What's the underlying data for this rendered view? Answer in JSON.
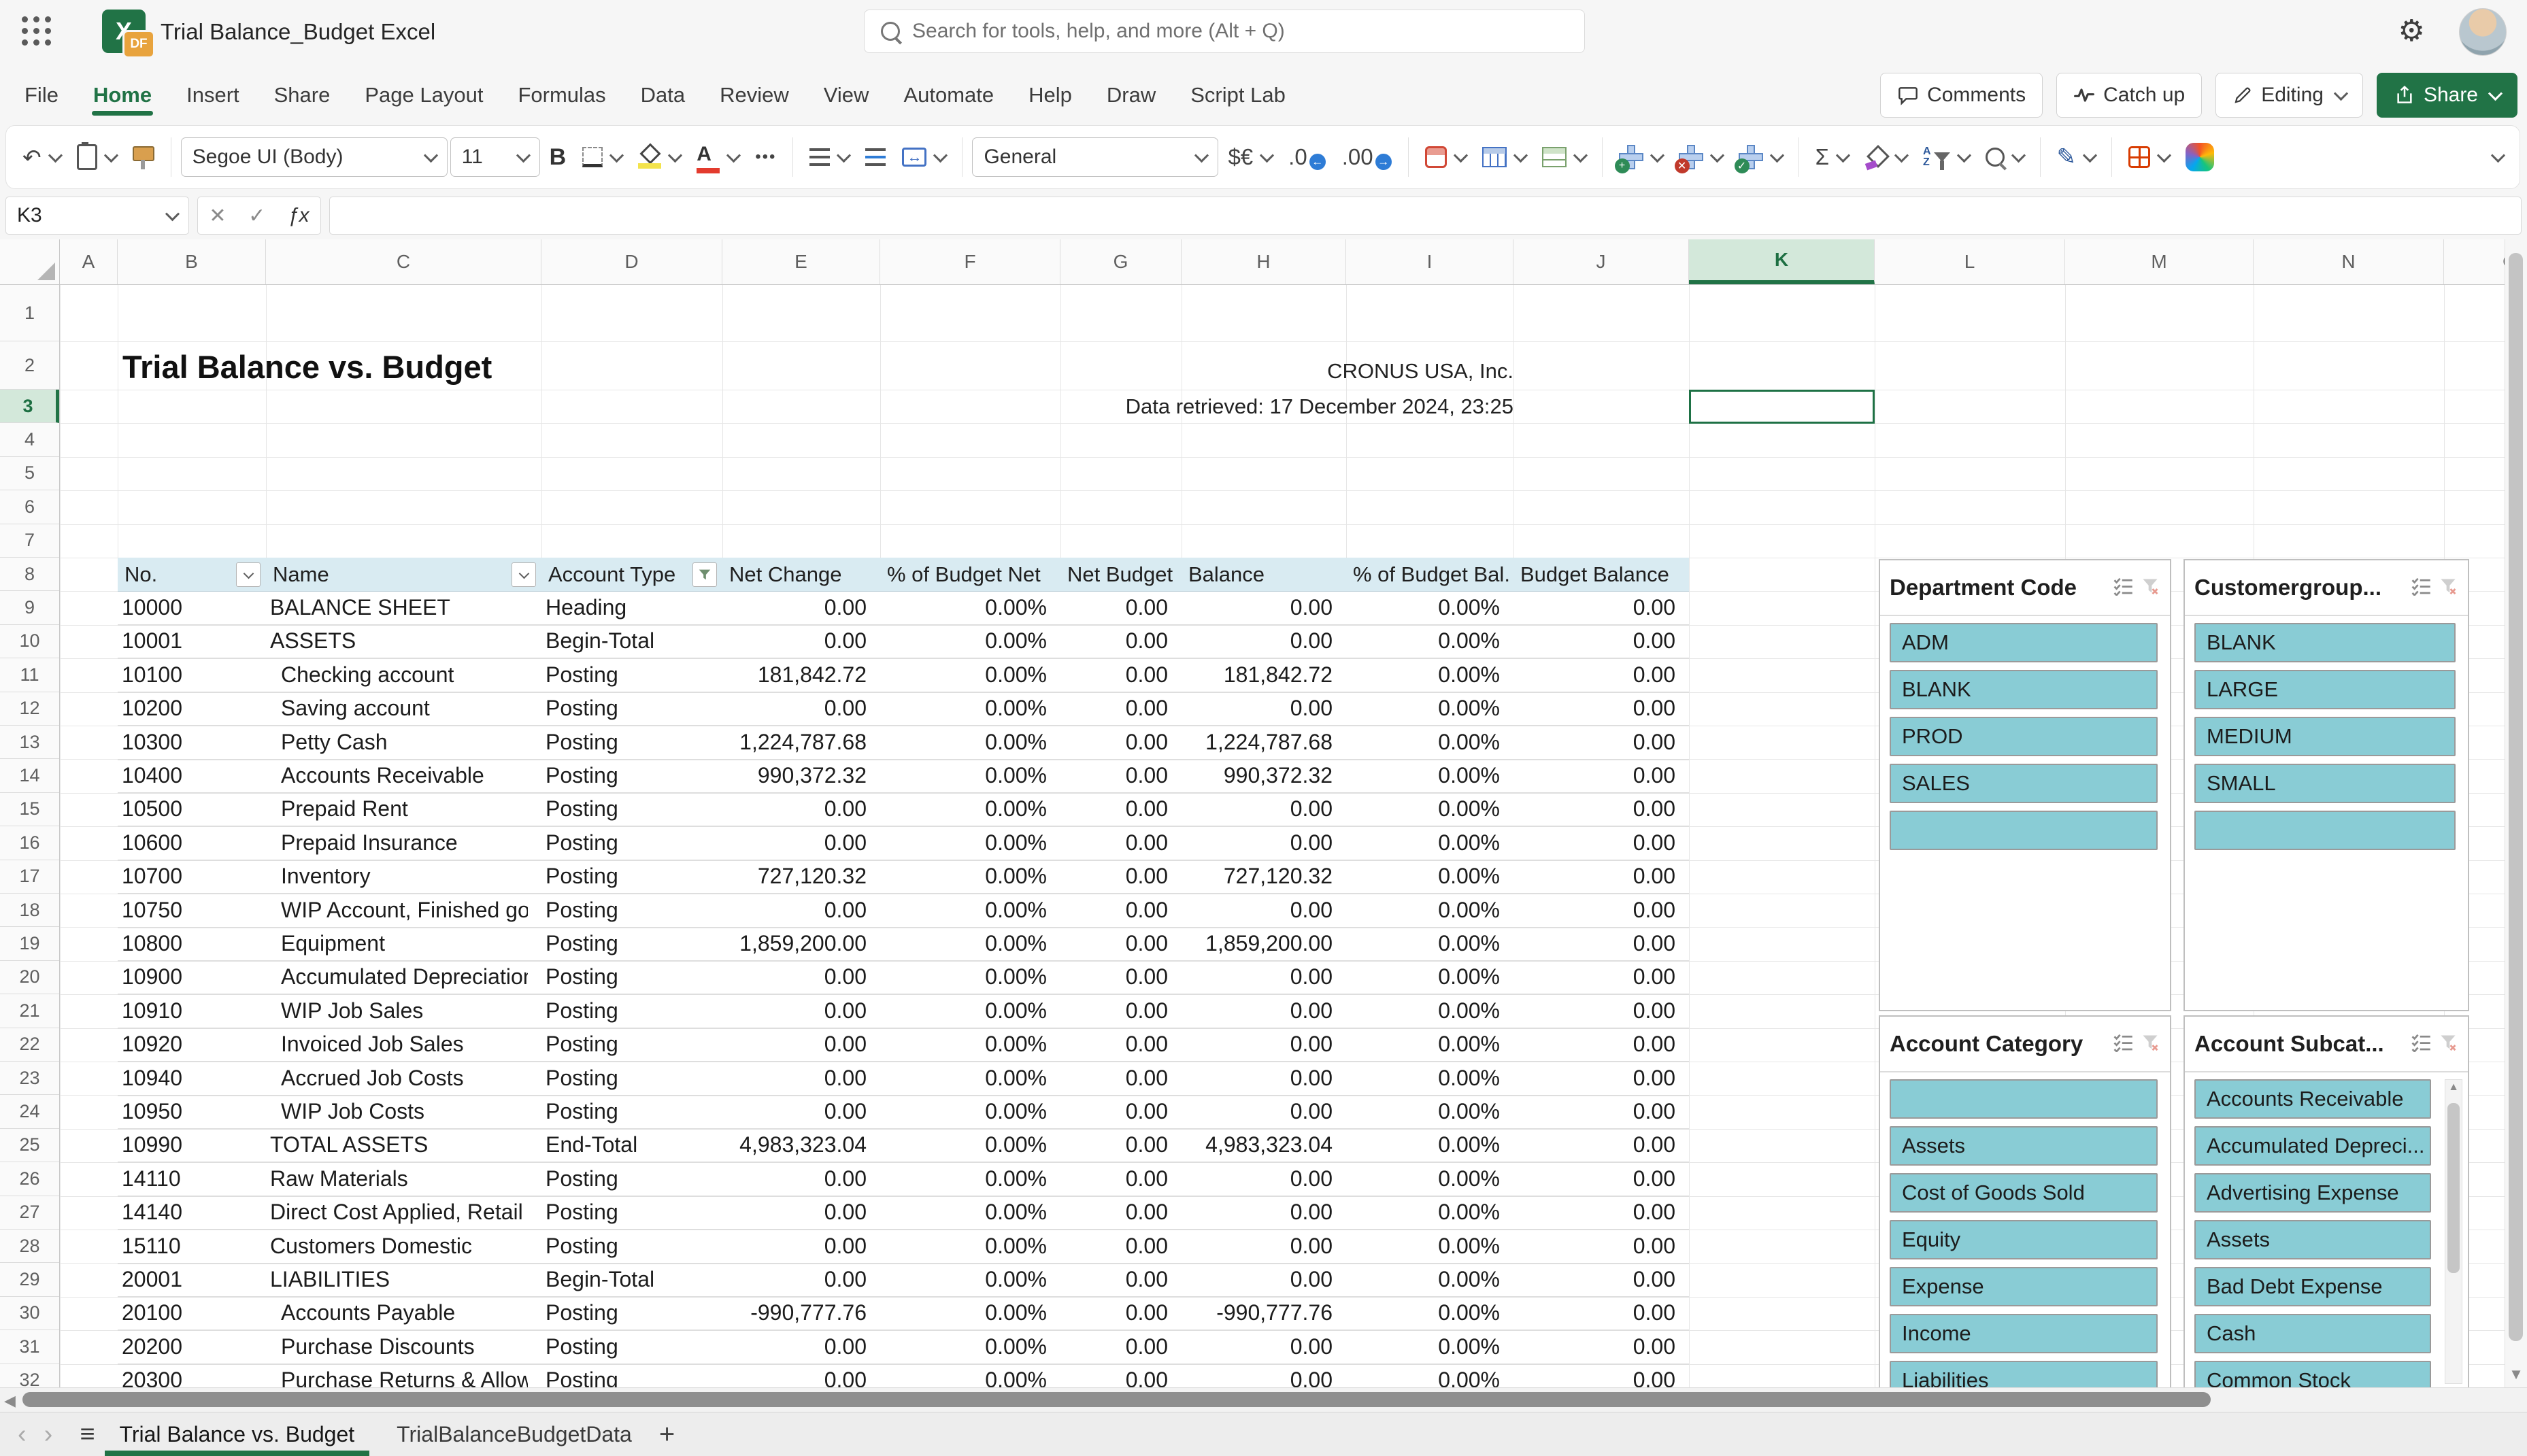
{
  "titlebar": {
    "app_title": "Trial Balance_Budget Excel",
    "search_placeholder": "Search for tools, help, and more (Alt + Q)",
    "excel_badge": "X",
    "df_badge": "DF"
  },
  "menubar": {
    "tabs": [
      "File",
      "Home",
      "Insert",
      "Share",
      "Page Layout",
      "Formulas",
      "Data",
      "Review",
      "View",
      "Automate",
      "Help",
      "Draw",
      "Script Lab"
    ],
    "active_tab": "Home",
    "comments_label": "Comments",
    "catchup_label": "Catch up",
    "editing_label": "Editing",
    "share_label": "Share"
  },
  "toolbar": {
    "font_name": "Segoe UI (Body)",
    "font_size": "11",
    "number_format": "General"
  },
  "formula_bar": {
    "cell_ref": "K3",
    "formula_value": ""
  },
  "sheet": {
    "columns": [
      "A",
      "B",
      "C",
      "D",
      "E",
      "F",
      "G",
      "H",
      "I",
      "J",
      "K",
      "L",
      "M",
      "N",
      "O"
    ],
    "selected_column": "K",
    "row_count": 32,
    "selected_row": 3,
    "title": "Trial Balance vs. Budget",
    "company": "CRONUS USA, Inc.",
    "retrieved": "Data retrieved: 17 December 2024, 23:25"
  },
  "table": {
    "headers": [
      "No.",
      "Name",
      "Account Type",
      "Net Change",
      "% of Budget Net",
      "Net Budget",
      "Balance",
      "% of Budget Bal.",
      "Budget Balance"
    ],
    "rows": [
      {
        "no": "10000",
        "name": "BALANCE SHEET",
        "indent": 0,
        "type": "Heading",
        "net_change": "0.00",
        "pct_net": "0.00%",
        "net_budget": "0.00",
        "balance": "0.00",
        "pct_bal": "0.00%",
        "budget_balance": "0.00"
      },
      {
        "no": "10001",
        "name": "ASSETS",
        "indent": 0,
        "type": "Begin-Total",
        "net_change": "0.00",
        "pct_net": "0.00%",
        "net_budget": "0.00",
        "balance": "0.00",
        "pct_bal": "0.00%",
        "budget_balance": "0.00"
      },
      {
        "no": "10100",
        "name": "Checking account",
        "indent": 1,
        "type": "Posting",
        "net_change": "181,842.72",
        "pct_net": "0.00%",
        "net_budget": "0.00",
        "balance": "181,842.72",
        "pct_bal": "0.00%",
        "budget_balance": "0.00"
      },
      {
        "no": "10200",
        "name": "Saving account",
        "indent": 1,
        "type": "Posting",
        "net_change": "0.00",
        "pct_net": "0.00%",
        "net_budget": "0.00",
        "balance": "0.00",
        "pct_bal": "0.00%",
        "budget_balance": "0.00"
      },
      {
        "no": "10300",
        "name": "Petty Cash",
        "indent": 1,
        "type": "Posting",
        "net_change": "1,224,787.68",
        "pct_net": "0.00%",
        "net_budget": "0.00",
        "balance": "1,224,787.68",
        "pct_bal": "0.00%",
        "budget_balance": "0.00"
      },
      {
        "no": "10400",
        "name": "Accounts Receivable",
        "indent": 1,
        "type": "Posting",
        "net_change": "990,372.32",
        "pct_net": "0.00%",
        "net_budget": "0.00",
        "balance": "990,372.32",
        "pct_bal": "0.00%",
        "budget_balance": "0.00"
      },
      {
        "no": "10500",
        "name": "Prepaid Rent",
        "indent": 1,
        "type": "Posting",
        "net_change": "0.00",
        "pct_net": "0.00%",
        "net_budget": "0.00",
        "balance": "0.00",
        "pct_bal": "0.00%",
        "budget_balance": "0.00"
      },
      {
        "no": "10600",
        "name": "Prepaid Insurance",
        "indent": 1,
        "type": "Posting",
        "net_change": "0.00",
        "pct_net": "0.00%",
        "net_budget": "0.00",
        "balance": "0.00",
        "pct_bal": "0.00%",
        "budget_balance": "0.00"
      },
      {
        "no": "10700",
        "name": "Inventory",
        "indent": 1,
        "type": "Posting",
        "net_change": "727,120.32",
        "pct_net": "0.00%",
        "net_budget": "0.00",
        "balance": "727,120.32",
        "pct_bal": "0.00%",
        "budget_balance": "0.00"
      },
      {
        "no": "10750",
        "name": "WIP Account, Finished goods",
        "indent": 1,
        "type": "Posting",
        "net_change": "0.00",
        "pct_net": "0.00%",
        "net_budget": "0.00",
        "balance": "0.00",
        "pct_bal": "0.00%",
        "budget_balance": "0.00"
      },
      {
        "no": "10800",
        "name": "Equipment",
        "indent": 1,
        "type": "Posting",
        "net_change": "1,859,200.00",
        "pct_net": "0.00%",
        "net_budget": "0.00",
        "balance": "1,859,200.00",
        "pct_bal": "0.00%",
        "budget_balance": "0.00"
      },
      {
        "no": "10900",
        "name": "Accumulated Depreciation",
        "indent": 1,
        "type": "Posting",
        "net_change": "0.00",
        "pct_net": "0.00%",
        "net_budget": "0.00",
        "balance": "0.00",
        "pct_bal": "0.00%",
        "budget_balance": "0.00"
      },
      {
        "no": "10910",
        "name": "WIP Job Sales",
        "indent": 1,
        "type": "Posting",
        "net_change": "0.00",
        "pct_net": "0.00%",
        "net_budget": "0.00",
        "balance": "0.00",
        "pct_bal": "0.00%",
        "budget_balance": "0.00"
      },
      {
        "no": "10920",
        "name": "Invoiced Job Sales",
        "indent": 1,
        "type": "Posting",
        "net_change": "0.00",
        "pct_net": "0.00%",
        "net_budget": "0.00",
        "balance": "0.00",
        "pct_bal": "0.00%",
        "budget_balance": "0.00"
      },
      {
        "no": "10940",
        "name": "Accrued Job Costs",
        "indent": 1,
        "type": "Posting",
        "net_change": "0.00",
        "pct_net": "0.00%",
        "net_budget": "0.00",
        "balance": "0.00",
        "pct_bal": "0.00%",
        "budget_balance": "0.00"
      },
      {
        "no": "10950",
        "name": "WIP Job Costs",
        "indent": 1,
        "type": "Posting",
        "net_change": "0.00",
        "pct_net": "0.00%",
        "net_budget": "0.00",
        "balance": "0.00",
        "pct_bal": "0.00%",
        "budget_balance": "0.00"
      },
      {
        "no": "10990",
        "name": "TOTAL ASSETS",
        "indent": 0,
        "type": "End-Total",
        "net_change": "4,983,323.04",
        "pct_net": "0.00%",
        "net_budget": "0.00",
        "balance": "4,983,323.04",
        "pct_bal": "0.00%",
        "budget_balance": "0.00"
      },
      {
        "no": "14110",
        "name": "Raw Materials",
        "indent": 0,
        "type": "Posting",
        "net_change": "0.00",
        "pct_net": "0.00%",
        "net_budget": "0.00",
        "balance": "0.00",
        "pct_bal": "0.00%",
        "budget_balance": "0.00"
      },
      {
        "no": "14140",
        "name": "Direct Cost Applied, Retail",
        "indent": 0,
        "type": "Posting",
        "net_change": "0.00",
        "pct_net": "0.00%",
        "net_budget": "0.00",
        "balance": "0.00",
        "pct_bal": "0.00%",
        "budget_balance": "0.00"
      },
      {
        "no": "15110",
        "name": "Customers Domestic",
        "indent": 0,
        "type": "Posting",
        "net_change": "0.00",
        "pct_net": "0.00%",
        "net_budget": "0.00",
        "balance": "0.00",
        "pct_bal": "0.00%",
        "budget_balance": "0.00"
      },
      {
        "no": "20001",
        "name": "LIABILITIES",
        "indent": 0,
        "type": "Begin-Total",
        "net_change": "0.00",
        "pct_net": "0.00%",
        "net_budget": "0.00",
        "balance": "0.00",
        "pct_bal": "0.00%",
        "budget_balance": "0.00"
      },
      {
        "no": "20100",
        "name": "Accounts Payable",
        "indent": 1,
        "type": "Posting",
        "net_change": "-990,777.76",
        "pct_net": "0.00%",
        "net_budget": "0.00",
        "balance": "-990,777.76",
        "pct_bal": "0.00%",
        "budget_balance": "0.00"
      },
      {
        "no": "20200",
        "name": "Purchase Discounts",
        "indent": 1,
        "type": "Posting",
        "net_change": "0.00",
        "pct_net": "0.00%",
        "net_budget": "0.00",
        "balance": "0.00",
        "pct_bal": "0.00%",
        "budget_balance": "0.00"
      },
      {
        "no": "20300",
        "name": "Purchase Returns & Allowances",
        "indent": 1,
        "type": "Posting",
        "net_change": "0.00",
        "pct_net": "0.00%",
        "net_budget": "0.00",
        "balance": "0.00",
        "pct_bal": "0.00%",
        "budget_balance": "0.00"
      }
    ]
  },
  "slicers": [
    {
      "title": "Department Code",
      "items": [
        "ADM",
        "BLANK",
        "PROD",
        "SALES",
        ""
      ]
    },
    {
      "title": "Customergroup...",
      "items": [
        "BLANK",
        "LARGE",
        "MEDIUM",
        "SMALL",
        ""
      ]
    },
    {
      "title": "Account Category",
      "items": [
        "",
        "Assets",
        "Cost of Goods Sold",
        "Equity",
        "Expense",
        "Income",
        "Liabilities"
      ]
    },
    {
      "title": "Account Subcat...",
      "items": [
        "Accounts Receivable",
        "Accumulated Depreci...",
        "Advertising Expense",
        "Assets",
        "Bad Debt Expense",
        "Cash",
        "Common Stock"
      ],
      "scrollbar": true
    }
  ],
  "footer": {
    "sheet_tabs": [
      "Trial Balance vs. Budget",
      "TrialBalanceBudgetData"
    ],
    "active_tab": "Trial Balance vs. Budget",
    "add_label": "+"
  },
  "glyphs": {
    "undo": "↶",
    "more": "•••",
    "bold": "B",
    "currency": "$€",
    "dec0": ".0",
    "dec00": ".00",
    "arrow_left": "←",
    "arrow_right": "→",
    "sum": "Σ",
    "ink": "✎",
    "gear": "⚙",
    "merge_arrow": "↔",
    "fx": "ƒx",
    "cancel": "✕",
    "confirm": "✓",
    "hamburger": "≡",
    "nav_left": "‹",
    "nav_right": "›",
    "tri_up": "▲",
    "tri_down": "▼",
    "tri_left": "◀",
    "sort_a": "A",
    "sort_z": "Z"
  },
  "colors": {
    "accent_green": "#217346",
    "selection_green": "#1e7145",
    "table_header_blue": "#d9ebf2",
    "slicer_teal": "#89ccd5"
  }
}
